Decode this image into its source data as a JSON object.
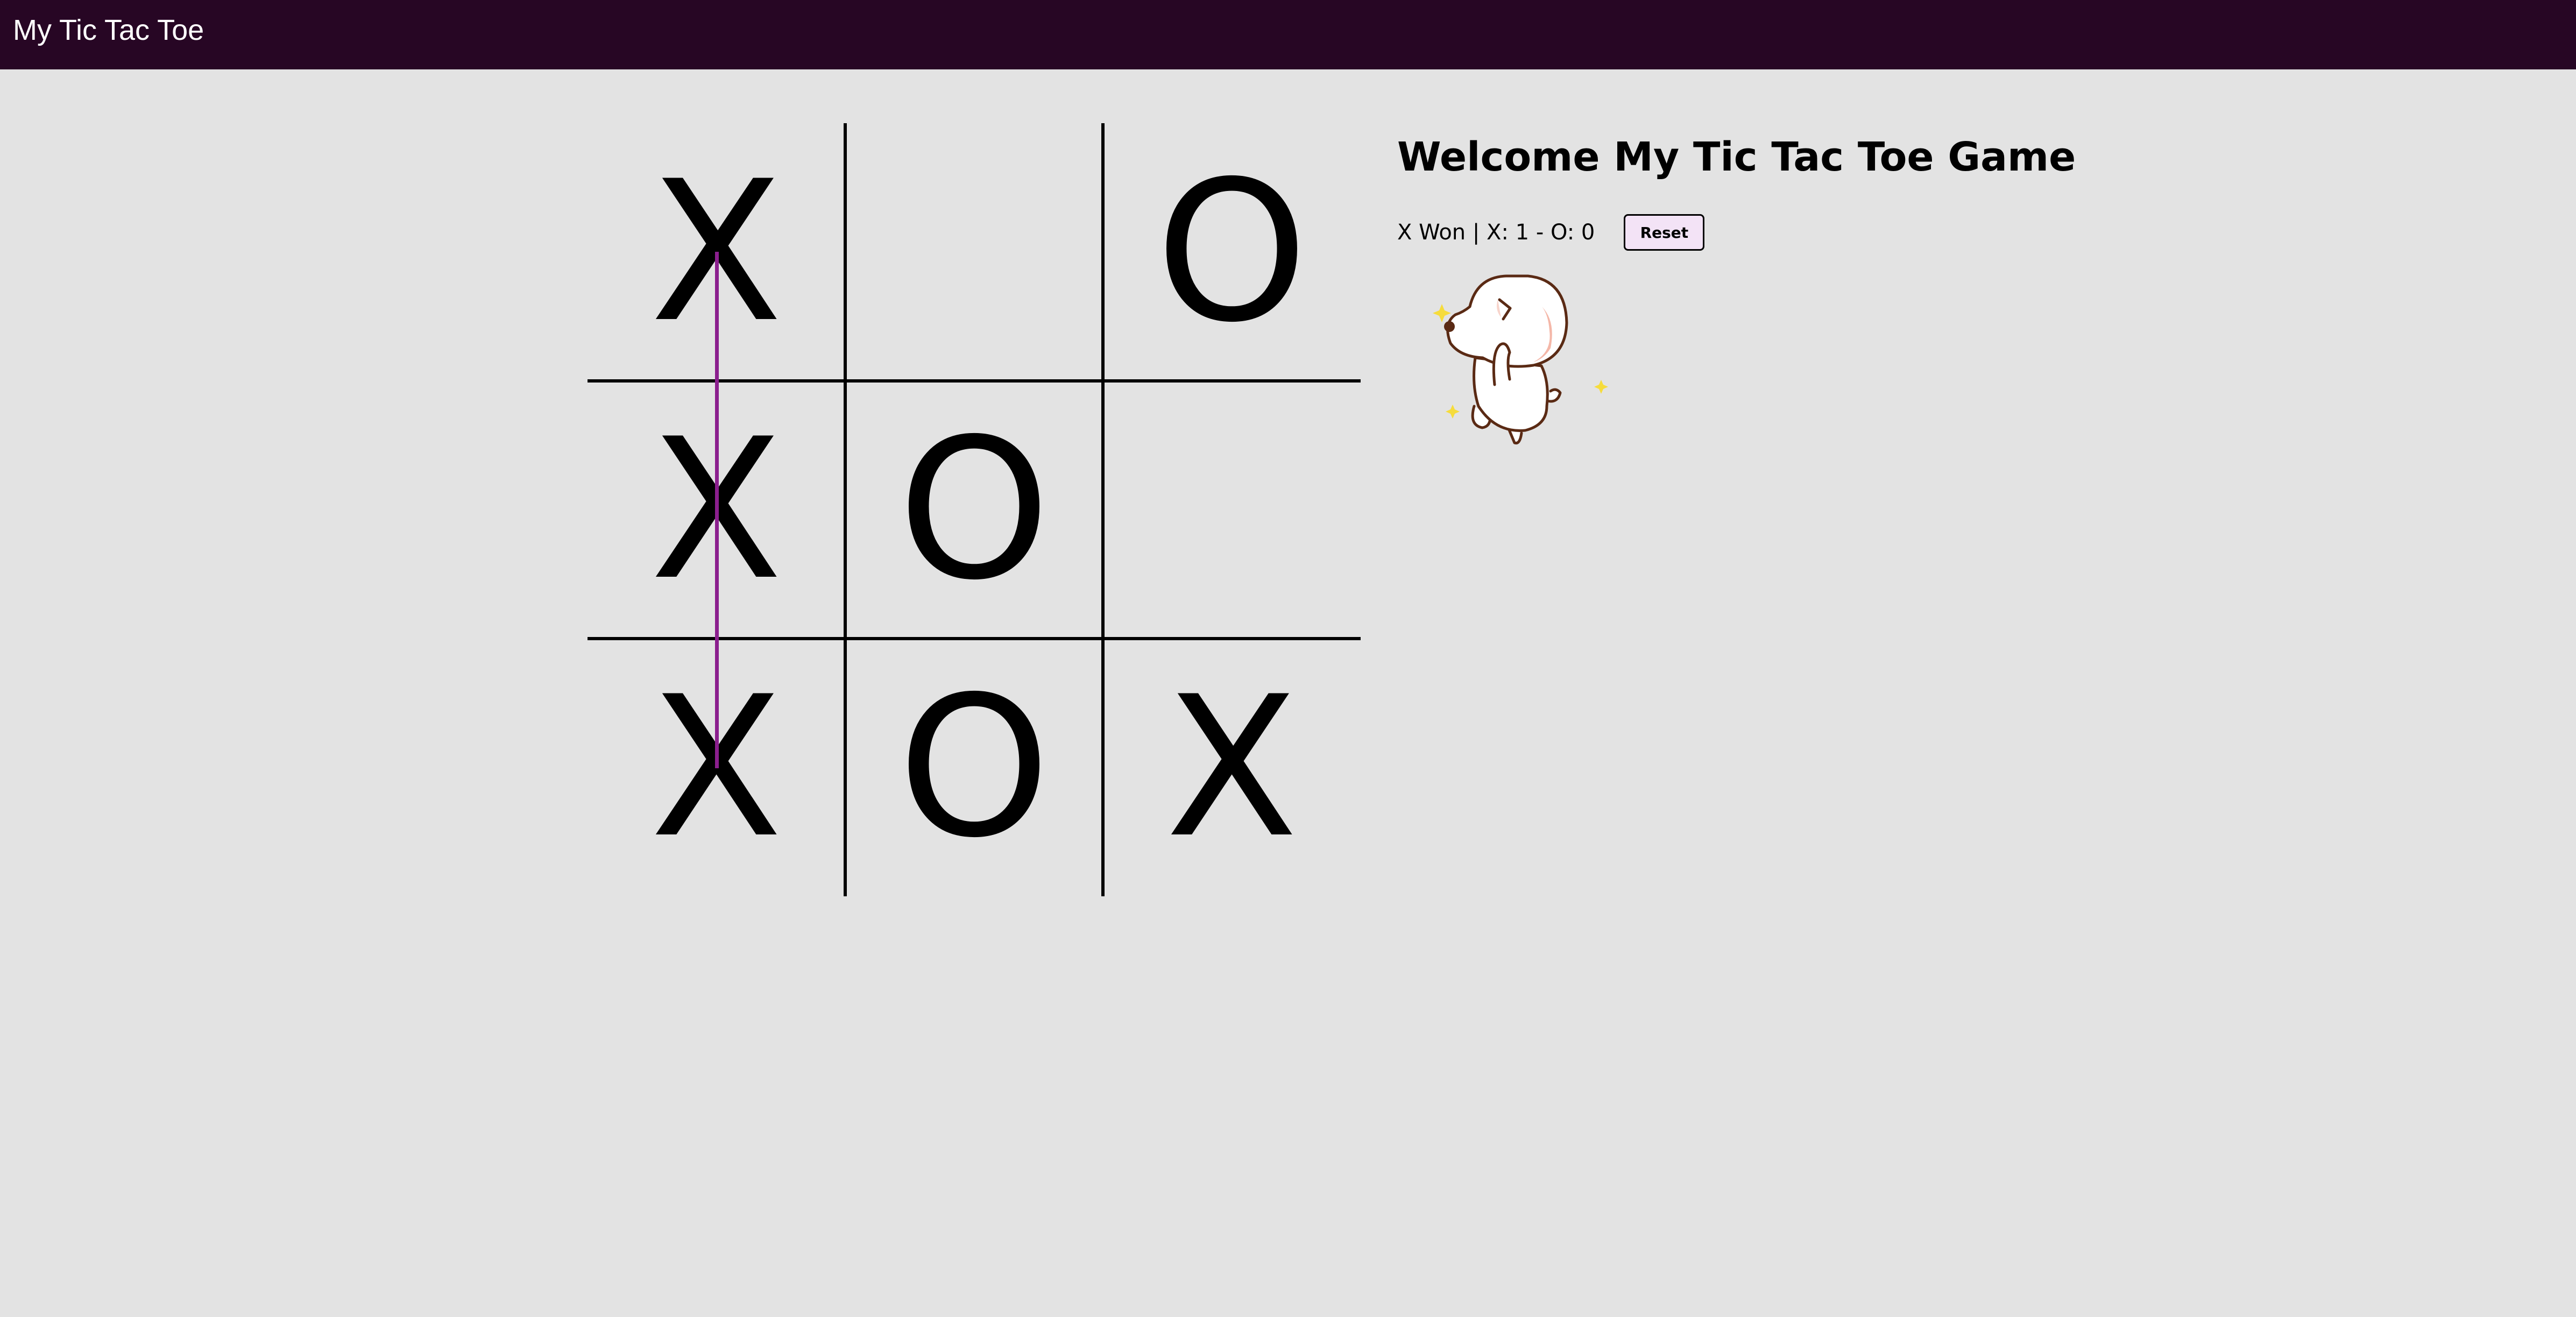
{
  "app": {
    "title": "My Tic Tac Toe"
  },
  "board": {
    "cells": [
      [
        "X",
        "",
        "O"
      ],
      [
        "X",
        "O",
        ""
      ],
      [
        "X",
        "O",
        "X"
      ]
    ],
    "winning_line": {
      "orientation": "vertical",
      "column": 0,
      "player": "X"
    }
  },
  "info": {
    "welcome": "Welcome My Tic Tac Toe Game",
    "status": "X Won | X: 1 - O: 0",
    "reset_label": "Reset"
  },
  "score": {
    "winner": "X",
    "x": 1,
    "o": 0
  },
  "mascot": {
    "icon": "dancing-puppy-sticker"
  },
  "colors": {
    "header_bg": "#270624",
    "page_bg": "#e3e3e3",
    "win_line": "#8b1f8e",
    "reset_bg": "#f3e3f6",
    "sparkle": "#f6dc3c"
  }
}
